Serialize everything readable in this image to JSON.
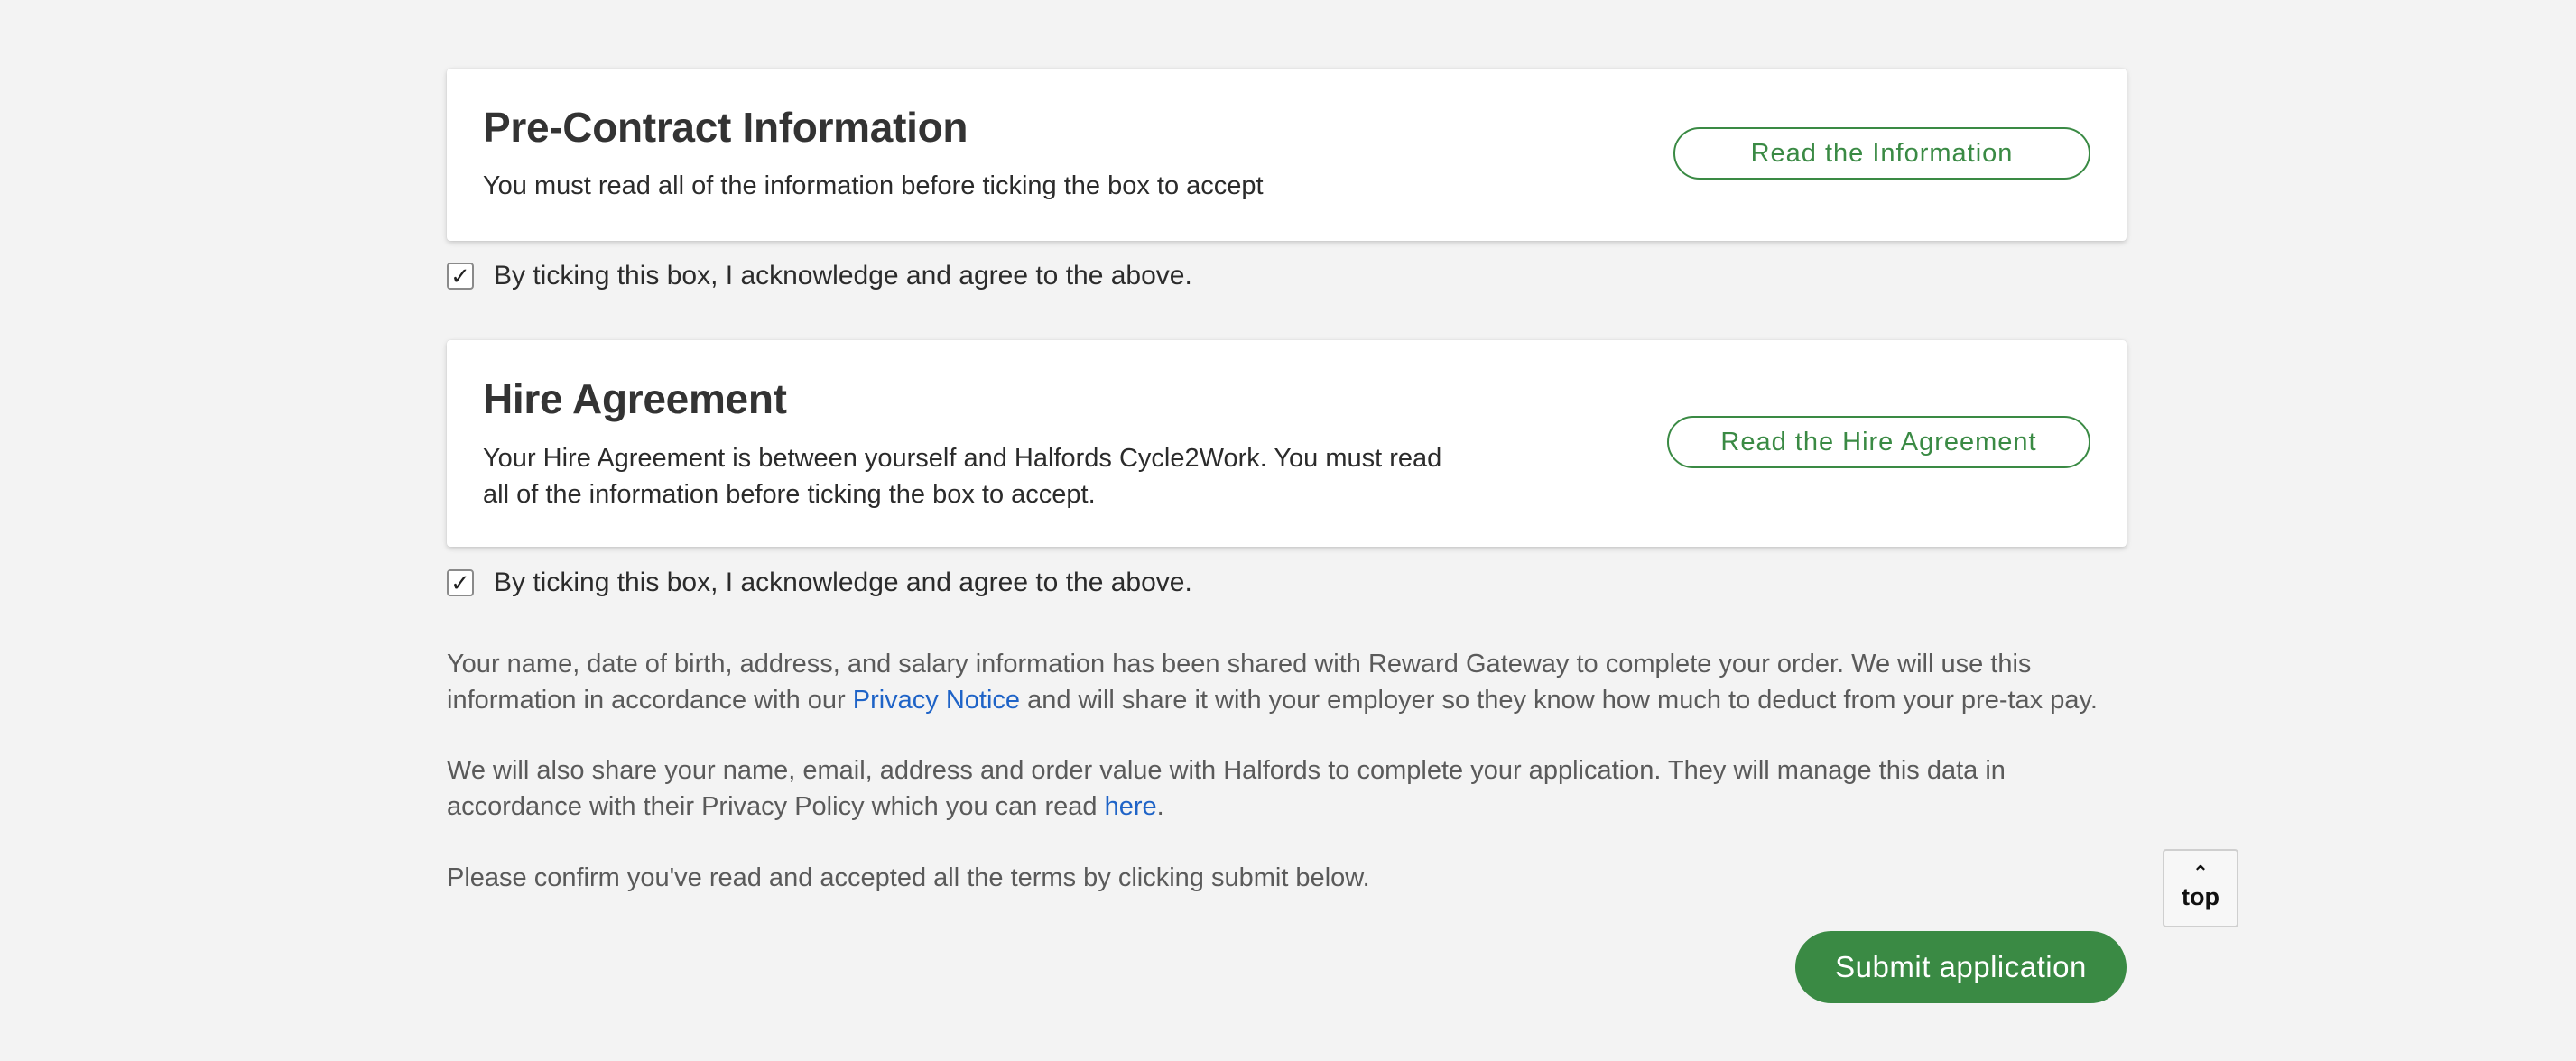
{
  "pre_contract": {
    "title": "Pre-Contract Information",
    "description": "You must read all of the information before ticking the box to accept",
    "button_label": "Read the Information",
    "checkbox_checked": true,
    "checkbox_mark": "✓",
    "checkbox_label": "By ticking this box, I acknowledge and agree to the above."
  },
  "hire_agreement": {
    "title": "Hire Agreement",
    "description_line1": "Your Hire Agreement is between yourself and Halfords Cycle2Work. You must read",
    "description_line2": "all of the information before ticking the box to accept.",
    "button_label": "Read the Hire Agreement",
    "checkbox_checked": true,
    "checkbox_mark": "✓",
    "checkbox_label": "By ticking this box, I acknowledge and agree to the above."
  },
  "privacy_paragraph": {
    "text_before": "Your name, date of birth, address, and salary information has been shared with Reward Gateway to complete your order. We will use this information in accordance with our ",
    "link_text": "Privacy Notice",
    "text_after": " and will share it with your employer so they know how much to deduct from your pre-tax pay."
  },
  "halfords_paragraph": {
    "text_before": "We will also share your name, email, address and order value with Halfords to complete your application. They will manage this data in accordance with their Privacy Policy which you can read ",
    "link_text": "here",
    "text_after": "."
  },
  "confirm_text": "Please confirm you've read and accepted all the terms by clicking submit below.",
  "top_button": {
    "icon": "chevron-up-icon",
    "label": "top"
  },
  "submit_label": "Submit application",
  "colors": {
    "accent_green": "#3a8a44",
    "link_blue": "#1e63c7",
    "background": "#f3f3f3"
  }
}
